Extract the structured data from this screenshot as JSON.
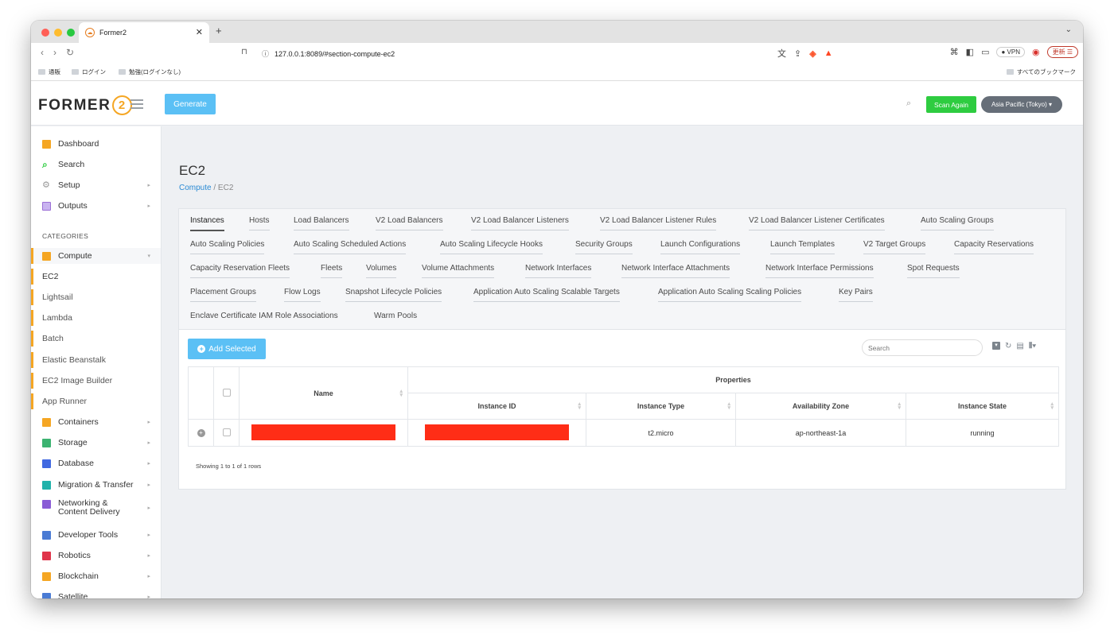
{
  "browser": {
    "tab_title": "Former2",
    "url": "127.0.0.1:8089/#section-compute-ec2",
    "vpn_label": "VPN",
    "update_label": "更新",
    "bookmarks": [
      "通販",
      "ログイン",
      "勉強(ログインなし)"
    ],
    "all_bookmarks": "すべてのブックマーク"
  },
  "header": {
    "logo_text": "FORMER",
    "logo_num": "2",
    "generate_label": "Generate",
    "scan_label": "Scan Again",
    "region_label": "Asia Pacific (Tokyo) ▾"
  },
  "sidebar": {
    "top_items": [
      {
        "label": "Dashboard",
        "color": "#f5a623"
      },
      {
        "label": "Search",
        "color": "#2ecc40"
      },
      {
        "label": "Setup",
        "color": "#999999"
      },
      {
        "label": "Outputs",
        "color": "#9b6fd6"
      }
    ],
    "categories_heading": "CATEGORIES",
    "compute_label": "Compute",
    "compute_children": [
      "EC2",
      "Lightsail",
      "Lambda",
      "Batch",
      "Elastic Beanstalk",
      "EC2 Image Builder",
      "App Runner"
    ],
    "categories": [
      {
        "label": "Containers",
        "color": "#f5a623"
      },
      {
        "label": "Storage",
        "color": "#3cb371"
      },
      {
        "label": "Database",
        "color": "#4169e1"
      },
      {
        "label": "Migration & Transfer",
        "color": "#20b2aa"
      },
      {
        "label": "Networking &",
        "label2": "Content Delivery",
        "color": "#8a5cd6"
      },
      {
        "label": "Developer Tools",
        "color": "#4a7bd4"
      },
      {
        "label": "Robotics",
        "color": "#e0344a"
      },
      {
        "label": "Blockchain",
        "color": "#f5a623"
      },
      {
        "label": "Satellite",
        "color": "#4a7bd4"
      }
    ]
  },
  "main": {
    "title": "EC2",
    "breadcrumb_parent": "Compute",
    "breadcrumb_sep": " / ",
    "breadcrumb_current": "EC2",
    "tab_rows": [
      [
        "Instances",
        "Hosts",
        "Load Balancers",
        "V2 Load Balancers",
        "V2 Load Balancer Listeners",
        "V2 Load Balancer Listener Rules",
        "V2 Load Balancer Listener Certificates",
        "Auto Scaling Groups"
      ],
      [
        "Auto Scaling Policies",
        "Auto Scaling Scheduled Actions",
        "Auto Scaling Lifecycle Hooks",
        "Security Groups",
        "Launch Configurations",
        "Launch Templates",
        "V2 Target Groups",
        "Capacity Reservations"
      ],
      [
        "Capacity Reservation Fleets",
        "Fleets",
        "Volumes",
        "Volume Attachments",
        "Network Interfaces",
        "Network Interface Attachments",
        "Network Interface Permissions",
        "Spot Requests"
      ],
      [
        "Placement Groups",
        "Flow Logs",
        "Snapshot Lifecycle Policies",
        "Application Auto Scaling Scalable Targets",
        "Application Auto Scaling Scaling Policies",
        "Key Pairs"
      ],
      [
        "Enclave Certificate IAM Role Associations",
        "Warm Pools"
      ]
    ],
    "add_selected_label": "Add Selected",
    "search_placeholder": "Search",
    "table": {
      "name_header": "Name",
      "properties_header": "Properties",
      "columns": [
        "Instance ID",
        "Instance Type",
        "Availability Zone",
        "Instance State"
      ],
      "rows": [
        {
          "instance_type": "t2.micro",
          "availability_zone": "ap-northeast-1a",
          "instance_state": "running"
        }
      ]
    },
    "showing_text": "Showing 1 to 1 of 1 rows"
  }
}
